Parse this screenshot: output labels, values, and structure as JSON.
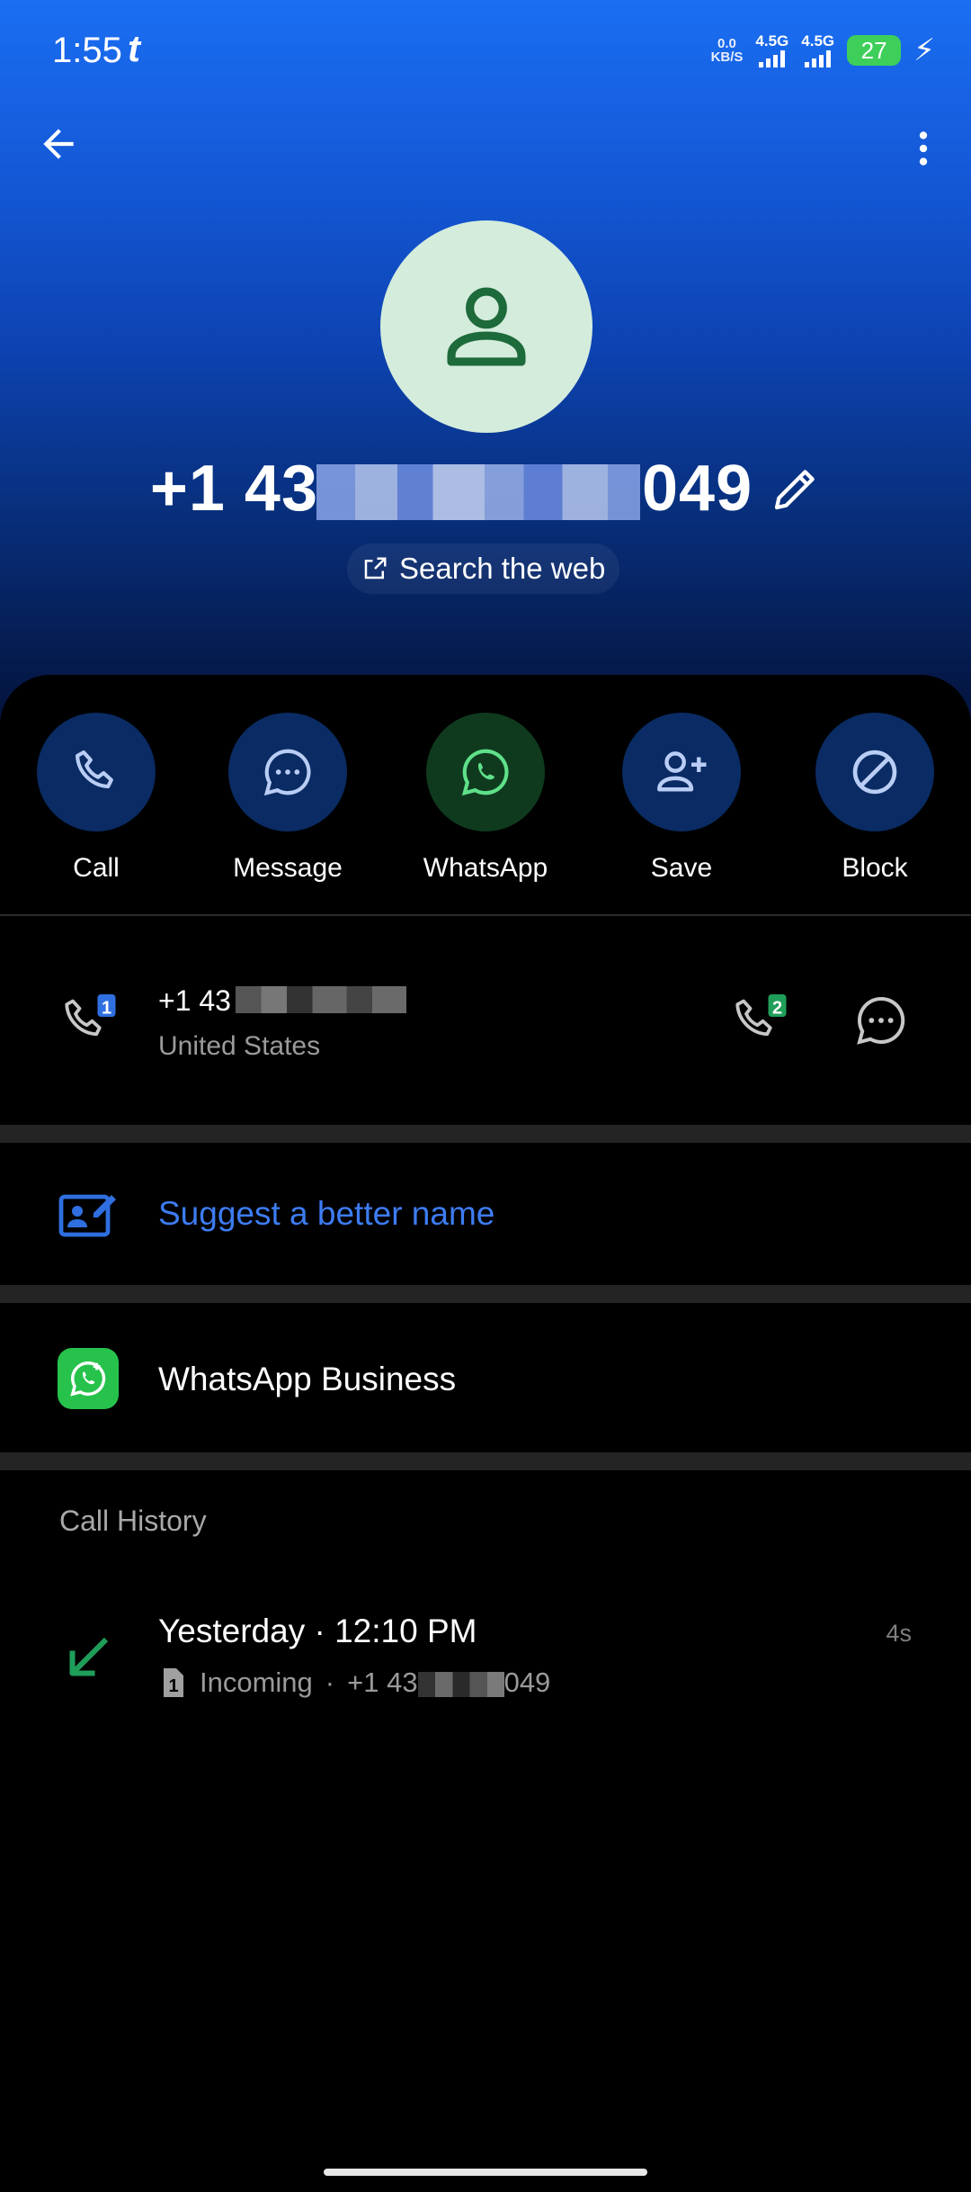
{
  "status_bar": {
    "time": "1:55",
    "app_logo": "t",
    "speed_top": "0.0",
    "speed_unit": "KB/S",
    "net1": "4.5G",
    "net2": "4.5G",
    "battery": "27"
  },
  "header": {
    "number_prefix": "+1 43",
    "number_suffix": "049",
    "search_web": "Search the web"
  },
  "actions": [
    {
      "label": "Call",
      "icon": "phone-icon"
    },
    {
      "label": "Message",
      "icon": "message-bubble-icon"
    },
    {
      "label": "WhatsApp",
      "icon": "whatsapp-icon"
    },
    {
      "label": "Save",
      "icon": "add-person-icon"
    },
    {
      "label": "Block",
      "icon": "block-icon"
    }
  ],
  "phone": {
    "number_prefix": "+1 43",
    "country": "United States",
    "sim1_badge": "1",
    "sim2_badge": "2"
  },
  "suggest": {
    "label": "Suggest a better name"
  },
  "whatsapp_business": {
    "label": "WhatsApp Business"
  },
  "call_history": {
    "title": "Call History",
    "entries": [
      {
        "when": "Yesterday · 12:10 PM",
        "duration": "4s",
        "type": "Incoming",
        "number_prefix": "+1 43",
        "number_suffix": "049",
        "sim_badge": "1"
      }
    ]
  },
  "colors": {
    "accent_blue": "#3d7cf2",
    "incoming_green": "#1f9e5a",
    "whatsapp_green": "#27c24c"
  }
}
